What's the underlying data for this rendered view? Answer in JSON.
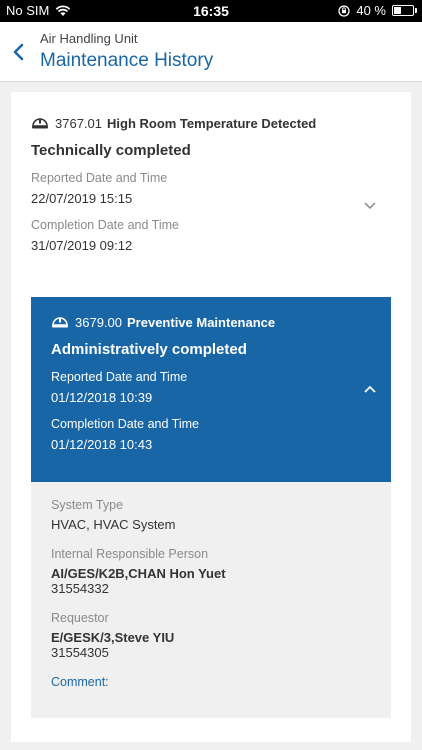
{
  "status_bar": {
    "carrier": "No SIM",
    "time": "16:35",
    "battery": "40 %",
    "battery_level": 0.4
  },
  "header": {
    "subtitle": "Air Handling Unit",
    "title": "Maintenance History"
  },
  "records": [
    {
      "order_no": "3767.01",
      "title": "High Room Temperature Detected",
      "status": "Technically completed",
      "reported_label": "Reported Date and Time",
      "reported_value": "22/07/2019 15:15",
      "completion_label": "Completion Date and Time",
      "completion_value": "31/07/2019 09:12",
      "expanded": false
    },
    {
      "order_no": "3679.00",
      "title": "Preventive Maintenance",
      "status": "Administratively completed",
      "reported_label": "Reported Date and Time",
      "reported_value": "01/12/2018 10:39",
      "completion_label": "Completion Date and Time",
      "completion_value": "01/12/2018 10:43",
      "expanded": true
    }
  ],
  "details": {
    "system_type_label": "System Type",
    "system_type_value": "HVAC, HVAC System",
    "responsible_label": "Internal Responsible Person",
    "responsible_name": "AI/GES/K2B,CHAN Hon Yuet",
    "responsible_phone": "31554332",
    "requestor_label": "Requestor",
    "requestor_name": "E/GESK/3,Steve YIU",
    "requestor_phone": "31554305",
    "comment_label": "Comment:"
  },
  "colors": {
    "accent": "#1966a6",
    "details_bg": "#f0f0f0"
  },
  "icons": {
    "back": "chevron-left-icon",
    "record": "helmet-icon",
    "collapsed": "chevron-down-icon",
    "expanded": "chevron-up-icon"
  }
}
